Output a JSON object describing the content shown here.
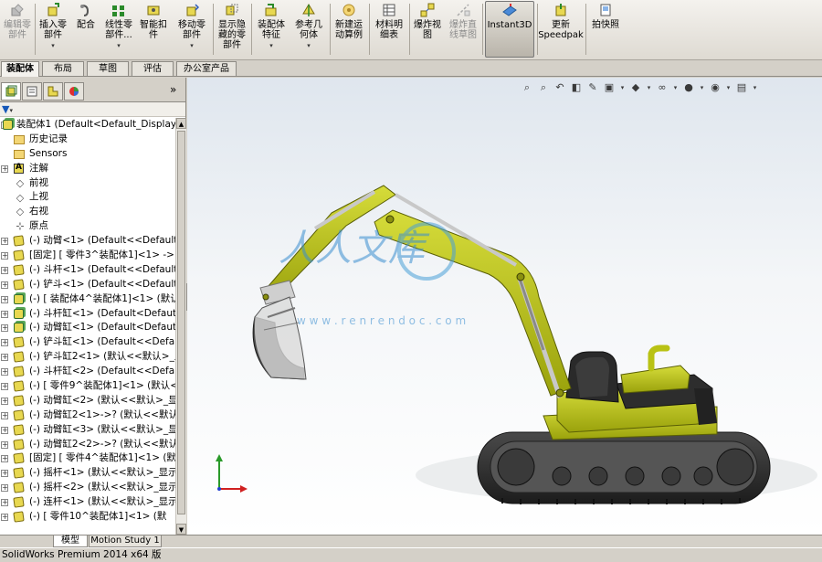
{
  "ribbon": {
    "buttons": [
      {
        "id": "edit-component",
        "label": "编辑零\n部件",
        "icon": "edit-component-icon",
        "disabled": true,
        "dropdown": false
      },
      {
        "id": "insert-components",
        "label": "插入零\n部件",
        "icon": "insert-component-icon",
        "disabled": false,
        "dropdown": true
      },
      {
        "id": "mate",
        "label": "配合",
        "icon": "mate-icon",
        "disabled": false,
        "dropdown": false
      },
      {
        "id": "linear-pattern",
        "label": "线性零\n部件...",
        "icon": "linear-pattern-icon",
        "disabled": false,
        "dropdown": true
      },
      {
        "id": "smart-fasteners",
        "label": "智能扣\n件",
        "icon": "smart-fastener-icon",
        "disabled": false,
        "dropdown": false
      },
      {
        "id": "move-component",
        "label": "移动零\n部件",
        "icon": "move-component-icon",
        "disabled": false,
        "dropdown": true
      },
      {
        "id": "show-hidden",
        "label": "显示隐\n藏的零\n部件",
        "icon": "show-hidden-icon",
        "disabled": false,
        "dropdown": false
      },
      {
        "id": "assembly-features",
        "label": "装配体\n特征",
        "icon": "assembly-feature-icon",
        "disabled": false,
        "dropdown": true
      },
      {
        "id": "reference-geometry",
        "label": "参考几\n何体",
        "icon": "reference-geometry-icon",
        "disabled": false,
        "dropdown": true
      },
      {
        "id": "new-motion-study",
        "label": "新建运\n动算例",
        "icon": "motion-study-icon",
        "disabled": false,
        "dropdown": false
      },
      {
        "id": "bom",
        "label": "材料明\n细表",
        "icon": "bom-icon",
        "disabled": false,
        "dropdown": false
      },
      {
        "id": "exploded-view",
        "label": "爆炸视\n图",
        "icon": "exploded-view-icon",
        "disabled": false,
        "dropdown": false
      },
      {
        "id": "explode-line",
        "label": "爆炸直\n线草图",
        "icon": "explode-line-icon",
        "disabled": true,
        "dropdown": false
      },
      {
        "id": "instant3d",
        "label": "Instant3D",
        "icon": "instant3d-icon",
        "disabled": false,
        "dropdown": false
      },
      {
        "id": "update-speedpak",
        "label": "更新\nSpeedpak",
        "icon": "speedpak-icon",
        "disabled": false,
        "dropdown": false
      },
      {
        "id": "take-snapshot",
        "label": "拍快照",
        "icon": "snapshot-icon",
        "disabled": false,
        "dropdown": false
      }
    ]
  },
  "command_tabs": [
    "装配体",
    "布局",
    "草图",
    "评估",
    "办公室产品"
  ],
  "active_command_tab": "装配体",
  "panel_tabs": [
    "feature-manager-icon",
    "property-manager-icon",
    "configuration-manager-icon",
    "display-manager-icon"
  ],
  "panel_expand": "»",
  "filter_icon": "funnel-icon",
  "tree": {
    "root": "装配体1  (Default<Default_Display",
    "items": [
      {
        "text": "历史记录",
        "icon": "folder",
        "expand": false
      },
      {
        "text": "Sensors",
        "icon": "folder",
        "expand": false
      },
      {
        "text": "注解",
        "icon": "note",
        "expand": true
      },
      {
        "text": "前视",
        "icon": "plane",
        "expand": false
      },
      {
        "text": "上视",
        "icon": "plane",
        "expand": false
      },
      {
        "text": "右视",
        "icon": "plane",
        "expand": false
      },
      {
        "text": "原点",
        "icon": "origin",
        "expand": false
      },
      {
        "text": "(-) 动臂<1> (Default<<Default.",
        "icon": "part",
        "expand": true
      },
      {
        "text": "[固定] [ 零件3^装配体1]<1> ->",
        "icon": "part",
        "expand": true
      },
      {
        "text": "(-) 斗杆<1> (Default<<Default:",
        "icon": "part",
        "expand": true
      },
      {
        "text": "(-) 铲斗<1> (Default<<Default:",
        "icon": "part",
        "expand": true
      },
      {
        "text": "(-) [ 装配体4^装配体1]<1> (默认",
        "icon": "asm",
        "expand": true
      },
      {
        "text": "(-) 斗杆缸<1> (Default<Defaut",
        "icon": "asm",
        "expand": true
      },
      {
        "text": "(-) 动臂缸<1> (Default<Defaut",
        "icon": "asm",
        "expand": true
      },
      {
        "text": "(-) 铲斗缸<1> (Default<<Defau",
        "icon": "part",
        "expand": true
      },
      {
        "text": "(-) 铲斗缸2<1> (默认<<默认>_显",
        "icon": "part",
        "expand": true
      },
      {
        "text": "(-) 斗杆缸<2> (Default<<Defau",
        "icon": "part",
        "expand": true
      },
      {
        "text": "(-) [ 零件9^装配体1]<1> (默认<",
        "icon": "part",
        "expand": true
      },
      {
        "text": "(-) 动臂缸<2> (默认<<默认>_显",
        "icon": "part",
        "expand": true
      },
      {
        "text": "(-) 动臂缸2<1>->? (默认<<默认",
        "icon": "part",
        "expand": true
      },
      {
        "text": "(-) 动臂缸<3> (默认<<默认>_显",
        "icon": "part",
        "expand": true
      },
      {
        "text": "(-) 动臂缸2<2>->? (默认<<默认",
        "icon": "part",
        "expand": true
      },
      {
        "text": "[固定] [ 零件4^装配体1]<1> (默",
        "icon": "part",
        "expand": true
      },
      {
        "text": "(-) 摇杆<1> (默认<<默认>_显示",
        "icon": "part",
        "expand": true
      },
      {
        "text": "(-) 摇杆<2> (默认<<默认>_显示",
        "icon": "part",
        "expand": true
      },
      {
        "text": "(-) 连杆<1> (默认<<默认>_显示",
        "icon": "part",
        "expand": true
      },
      {
        "text": "(-) [ 零件10^装配体1]<1> (默",
        "icon": "part",
        "expand": true
      }
    ]
  },
  "bottom_tabs": [
    "模型",
    "Motion Study 1"
  ],
  "active_bottom_tab": "模型",
  "status_bar": "SolidWorks Premium 2014 x64 版",
  "watermark": {
    "brand": "人人文库",
    "url": "w w w . r e n r e n d o c . c o m"
  },
  "colors": {
    "machine_yellow": "#b9c214",
    "machine_dark": "#2c2c2c",
    "ribbon_bg": "#dedad2"
  }
}
